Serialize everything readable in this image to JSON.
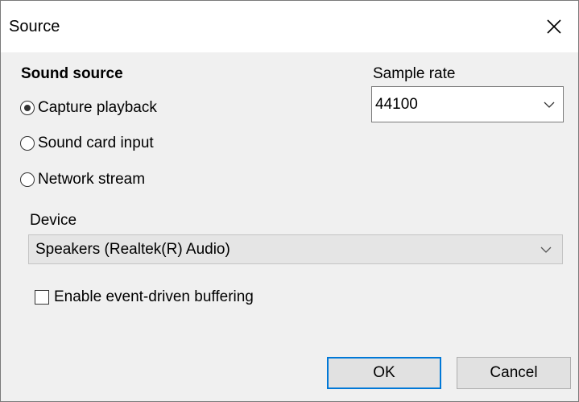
{
  "window": {
    "title": "Source"
  },
  "sound_source": {
    "label": "Sound source",
    "options": [
      {
        "label": "Capture playback",
        "checked": true
      },
      {
        "label": "Sound card input",
        "checked": false
      },
      {
        "label": "Network stream",
        "checked": false
      }
    ]
  },
  "sample_rate": {
    "label": "Sample rate",
    "value": "44100"
  },
  "device": {
    "label": "Device",
    "value": "Speakers (Realtek(R) Audio)"
  },
  "event_buffering": {
    "label": "Enable event-driven buffering",
    "checked": false
  },
  "buttons": {
    "ok": "OK",
    "cancel": "Cancel"
  },
  "colors": {
    "accent": "#0078d7",
    "dialog_bg": "#f0f0f0",
    "title_bg": "#ffffff"
  },
  "icons": {
    "close": "close-icon",
    "dropdown": "chevron-down-icon"
  }
}
